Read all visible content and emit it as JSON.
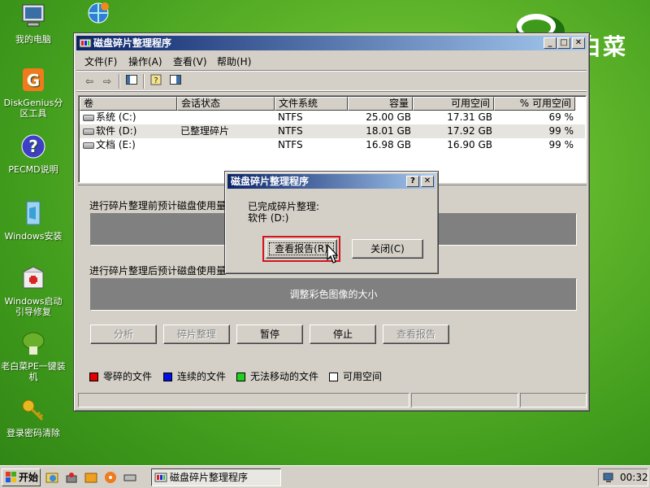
{
  "desktop": {
    "icons": [
      {
        "label": "我的电脑",
        "icon": "my-computer-icon"
      },
      {
        "label": "DiskGenius分区工具",
        "icon": "diskgenius-icon"
      },
      {
        "label": "PECMD说明",
        "icon": "help-icon"
      },
      {
        "label": "Windows安装",
        "icon": "windows-install-icon"
      },
      {
        "label": "Windows启动引导修复",
        "icon": "boot-repair-icon"
      },
      {
        "label": "老白菜PE一键装机",
        "icon": "cabbage-icon"
      },
      {
        "label": "登录密码清除",
        "icon": "key-icon"
      },
      {
        "label": "",
        "icon": "network-globe-icon"
      }
    ],
    "brand_text": "白菜"
  },
  "main_window": {
    "title": "磁盘碎片整理程序",
    "menu": [
      "文件(F)",
      "操作(A)",
      "查看(V)",
      "帮助(H)"
    ],
    "columns": [
      "卷",
      "会话状态",
      "文件系统",
      "容量",
      "可用空间",
      "% 可用空间"
    ],
    "volumes": [
      {
        "name": "系统 (C:)",
        "status": "",
        "fs": "NTFS",
        "capacity": "25.00 GB",
        "free": "17.31 GB",
        "pct": "69 %"
      },
      {
        "name": "软件 (D:)",
        "status": "已整理碎片",
        "fs": "NTFS",
        "capacity": "18.01 GB",
        "free": "17.92 GB",
        "pct": "99 %"
      },
      {
        "name": "文档 (E:)",
        "status": "",
        "fs": "NTFS",
        "capacity": "16.98 GB",
        "free": "16.90 GB",
        "pct": "99 %"
      }
    ],
    "before_label": "进行碎片整理前预计磁盘使用量:",
    "after_label": "进行碎片整理后预计磁盘使用量:",
    "after_bar_text": "调整彩色图像的大小",
    "buttons": {
      "analyze": "分析",
      "defrag": "碎片整理",
      "pause": "暂停",
      "stop": "停止",
      "report": "查看报告"
    },
    "legend": [
      {
        "label": "零碎的文件",
        "color": "#e00000"
      },
      {
        "label": "连续的文件",
        "color": "#0010e0"
      },
      {
        "label": "无法移动的文件",
        "color": "#20d020"
      },
      {
        "label": "可用空间",
        "color": "#ffffff"
      }
    ]
  },
  "dialog": {
    "title": "磁盘碎片整理程序",
    "message": "已完成碎片整理:",
    "volume": "软件 (D:)",
    "view_report": "查看报告(R)",
    "close": "关闭(C)"
  },
  "taskbar": {
    "start": "开始",
    "active_task": "磁盘碎片整理程序",
    "clock": "00:32"
  }
}
